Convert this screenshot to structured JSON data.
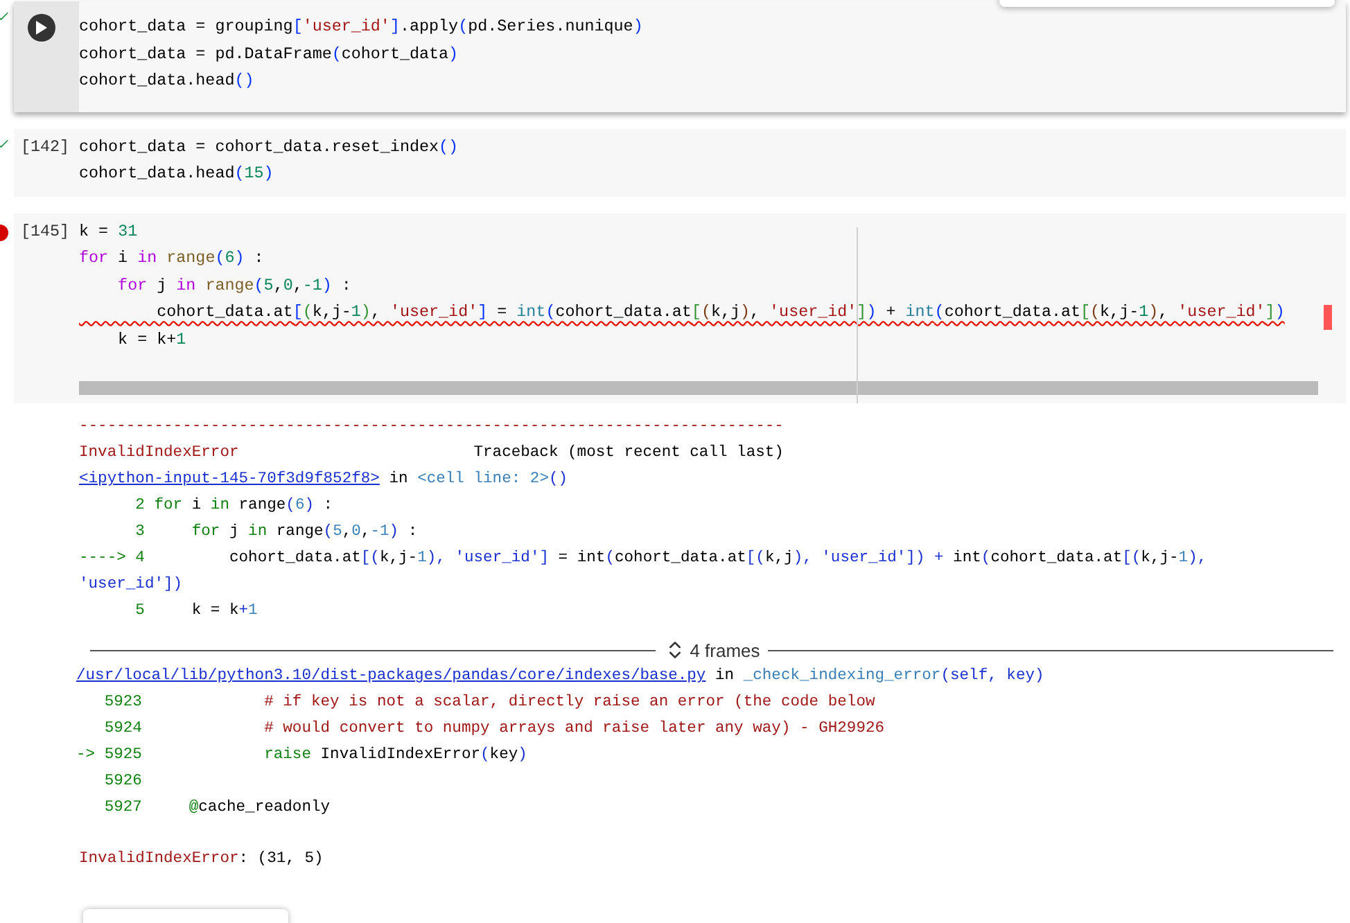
{
  "cells": [
    {
      "focused": true,
      "failed": false,
      "lines": [
        {
          "squiggle": false,
          "segments": [
            {
              "text": "cohort_data = grouping",
              "kind": "plain"
            },
            {
              "text": "[",
              "kind": "b1"
            },
            {
              "text": "'user_id'",
              "kind": "str"
            },
            {
              "text": "]",
              "kind": "b1"
            },
            {
              "text": ".apply",
              "kind": "plain"
            },
            {
              "text": "(",
              "kind": "b1"
            },
            {
              "text": "pd.Series.nunique",
              "kind": "plain"
            },
            {
              "text": ")",
              "kind": "b1"
            }
          ]
        },
        {
          "squiggle": false,
          "segments": [
            {
              "text": "cohort_data = pd.DataFrame",
              "kind": "plain"
            },
            {
              "text": "(",
              "kind": "b1"
            },
            {
              "text": "cohort_data",
              "kind": "plain"
            },
            {
              "text": ")",
              "kind": "b1"
            }
          ]
        },
        {
          "squiggle": false,
          "segments": [
            {
              "text": "cohort_data.head",
              "kind": "plain"
            },
            {
              "text": "()",
              "kind": "b1"
            }
          ]
        }
      ]
    },
    {
      "focused": false,
      "failed": false,
      "count": "[142]",
      "lines": [
        {
          "squiggle": false,
          "segments": [
            {
              "text": "cohort_data = cohort_data.reset_index",
              "kind": "plain"
            },
            {
              "text": "()",
              "kind": "b1"
            }
          ]
        },
        {
          "squiggle": false,
          "segments": [
            {
              "text": "cohort_data.head",
              "kind": "plain"
            },
            {
              "text": "(",
              "kind": "b1"
            },
            {
              "text": "15",
              "kind": "num"
            },
            {
              "text": ")",
              "kind": "b1"
            }
          ]
        }
      ]
    },
    {
      "focused": false,
      "failed": true,
      "count": "[145]",
      "scrollbar": true,
      "lines": [
        {
          "squiggle": false,
          "segments": [
            {
              "text": "k = ",
              "kind": "plain"
            },
            {
              "text": "31",
              "kind": "num"
            }
          ]
        },
        {
          "squiggle": false,
          "segments": [
            {
              "text": "for",
              "kind": "kw"
            },
            {
              "text": " i ",
              "kind": "plain"
            },
            {
              "text": "in",
              "kind": "kw"
            },
            {
              "text": " range",
              "kind": "fn"
            },
            {
              "text": "(",
              "kind": "b1"
            },
            {
              "text": "6",
              "kind": "num"
            },
            {
              "text": ")",
              "kind": "b1"
            },
            {
              "text": " :",
              "kind": "plain"
            }
          ]
        },
        {
          "squiggle": false,
          "segments": [
            {
              "text": "    for",
              "kind": "kw"
            },
            {
              "text": " j ",
              "kind": "plain"
            },
            {
              "text": "in",
              "kind": "kw"
            },
            {
              "text": " range",
              "kind": "fn"
            },
            {
              "text": "(",
              "kind": "b1"
            },
            {
              "text": "5",
              "kind": "num"
            },
            {
              "text": ",",
              "kind": "plain"
            },
            {
              "text": "0",
              "kind": "num"
            },
            {
              "text": ",",
              "kind": "plain"
            },
            {
              "text": "-1",
              "kind": "num"
            },
            {
              "text": ")",
              "kind": "b1"
            },
            {
              "text": " :",
              "kind": "plain"
            }
          ]
        },
        {
          "squiggle": true,
          "segments": [
            {
              "text": "        cohort_data.at",
              "kind": "plain"
            },
            {
              "text": "[",
              "kind": "b1"
            },
            {
              "text": "(",
              "kind": "b2"
            },
            {
              "text": "k,j-",
              "kind": "plain"
            },
            {
              "text": "1",
              "kind": "num"
            },
            {
              "text": ")",
              "kind": "b2"
            },
            {
              "text": ", ",
              "kind": "plain"
            },
            {
              "text": "'user_id'",
              "kind": "str"
            },
            {
              "text": "]",
              "kind": "b1"
            },
            {
              "text": " = ",
              "kind": "plain"
            },
            {
              "text": "int",
              "kind": "builtin"
            },
            {
              "text": "(",
              "kind": "b1"
            },
            {
              "text": "cohort_data.at",
              "kind": "plain"
            },
            {
              "text": "[",
              "kind": "b2"
            },
            {
              "text": "(",
              "kind": "b3"
            },
            {
              "text": "k,j",
              "kind": "plain"
            },
            {
              "text": ")",
              "kind": "b3"
            },
            {
              "text": ", ",
              "kind": "plain"
            },
            {
              "text": "'user_id'",
              "kind": "str"
            },
            {
              "text": "]",
              "kind": "b2"
            },
            {
              "text": ")",
              "kind": "b1"
            },
            {
              "text": " + ",
              "kind": "plain"
            },
            {
              "text": "int",
              "kind": "builtin"
            },
            {
              "text": "(",
              "kind": "b1"
            },
            {
              "text": "cohort_data.at",
              "kind": "plain"
            },
            {
              "text": "[",
              "kind": "b2"
            },
            {
              "text": "(",
              "kind": "b3"
            },
            {
              "text": "k,j-",
              "kind": "plain"
            },
            {
              "text": "1",
              "kind": "num"
            },
            {
              "text": ")",
              "kind": "b3"
            },
            {
              "text": ", ",
              "kind": "plain"
            },
            {
              "text": "'user_id'",
              "kind": "str"
            },
            {
              "text": "]",
              "kind": "b2"
            },
            {
              "text": ")",
              "kind": "b1"
            }
          ]
        },
        {
          "squiggle": false,
          "segments": [
            {
              "text": "    k = k+",
              "kind": "plain"
            },
            {
              "text": "1",
              "kind": "num"
            }
          ]
        }
      ]
    }
  ],
  "output": {
    "header": [
      [
        {
          "text": "---------------------------------------------------------------------------",
          "kind": "err"
        }
      ],
      [
        {
          "text": "InvalidIndexError",
          "kind": "err"
        },
        {
          "text": "                         Traceback (most recent call last)",
          "kind": "plain"
        }
      ],
      [
        {
          "text": "<ipython-input-145-70f3d9f852f8>",
          "kind": "link"
        },
        {
          "text": " in ",
          "kind": "plain"
        },
        {
          "text": "<cell line: 2>",
          "kind": "func"
        },
        {
          "text": "()",
          "kind": "blue"
        }
      ],
      [
        {
          "text": "      2 for",
          "kind": "green"
        },
        {
          "text": " i ",
          "kind": "plain"
        },
        {
          "text": "in",
          "kind": "green"
        },
        {
          "text": " range",
          "kind": "plain"
        },
        {
          "text": "(",
          "kind": "blue"
        },
        {
          "text": "6",
          "kind": "val"
        },
        {
          "text": ")",
          "kind": "blue"
        },
        {
          "text": " :",
          "kind": "plain"
        }
      ],
      [
        {
          "text": "      3     for",
          "kind": "green"
        },
        {
          "text": " j ",
          "kind": "plain"
        },
        {
          "text": "in",
          "kind": "green"
        },
        {
          "text": " range",
          "kind": "plain"
        },
        {
          "text": "(",
          "kind": "blue"
        },
        {
          "text": "5",
          "kind": "val"
        },
        {
          "text": ",",
          "kind": "plain"
        },
        {
          "text": "0",
          "kind": "val"
        },
        {
          "text": ",",
          "kind": "plain"
        },
        {
          "text": "-1",
          "kind": "val"
        },
        {
          "text": ")",
          "kind": "blue"
        },
        {
          "text": " :",
          "kind": "plain"
        }
      ],
      [
        {
          "text": "----> 4",
          "kind": "green"
        },
        {
          "text": "         cohort_data.at",
          "kind": "plain"
        },
        {
          "text": "[(",
          "kind": "blue"
        },
        {
          "text": "k,j-",
          "kind": "plain"
        },
        {
          "text": "1",
          "kind": "val"
        },
        {
          "text": "), 'user_id']",
          "kind": "blue"
        },
        {
          "text": " = int",
          "kind": "plain"
        },
        {
          "text": "(",
          "kind": "blue"
        },
        {
          "text": "cohort_data.at",
          "kind": "plain"
        },
        {
          "text": "[(",
          "kind": "blue"
        },
        {
          "text": "k,j",
          "kind": "plain"
        },
        {
          "text": "), 'user_id']) +",
          "kind": "blue"
        },
        {
          "text": " int",
          "kind": "plain"
        },
        {
          "text": "(",
          "kind": "blue"
        },
        {
          "text": "cohort_data.at",
          "kind": "plain"
        },
        {
          "text": "[(",
          "kind": "blue"
        },
        {
          "text": "k,j-",
          "kind": "plain"
        },
        {
          "text": "1",
          "kind": "val"
        },
        {
          "text": "),",
          "kind": "blue"
        }
      ],
      [
        {
          "text": "'user_id'])",
          "kind": "blue"
        }
      ],
      [
        {
          "text": "      5",
          "kind": "green"
        },
        {
          "text": "     k = k",
          "kind": "plain"
        },
        {
          "text": "+",
          "kind": "blue"
        },
        {
          "text": "1",
          "kind": "val"
        }
      ]
    ],
    "collapsed_label": "4 frames",
    "frame": [
      [
        {
          "text": "/usr/local/lib/python3.10/dist-packages/pandas/core/indexes/base.py",
          "kind": "link"
        },
        {
          "text": " in ",
          "kind": "plain"
        },
        {
          "text": "_check_indexing_error",
          "kind": "func"
        },
        {
          "text": "(self, key)",
          "kind": "blue"
        }
      ],
      [
        {
          "text": "   5923",
          "kind": "green"
        },
        {
          "text": "             # if key is not a scalar, directly raise an error (the code below",
          "kind": "err"
        }
      ],
      [
        {
          "text": "   5924",
          "kind": "green"
        },
        {
          "text": "             # would convert to numpy arrays and raise later any way) - GH29926",
          "kind": "err"
        }
      ],
      [
        {
          "text": "-> 5925             raise",
          "kind": "green"
        },
        {
          "text": " InvalidIndexError",
          "kind": "plain"
        },
        {
          "text": "(",
          "kind": "blue"
        },
        {
          "text": "key",
          "kind": "plain"
        },
        {
          "text": ")",
          "kind": "blue"
        }
      ],
      [
        {
          "text": "   5926",
          "kind": "green"
        }
      ],
      [
        {
          "text": "   5927     @",
          "kind": "green"
        },
        {
          "text": "cache_readonly",
          "kind": "plain"
        }
      ]
    ],
    "summary": [
      {
        "text": "InvalidIndexError",
        "kind": "err"
      },
      {
        "text": ": (31, 5)",
        "kind": "plain"
      }
    ]
  }
}
